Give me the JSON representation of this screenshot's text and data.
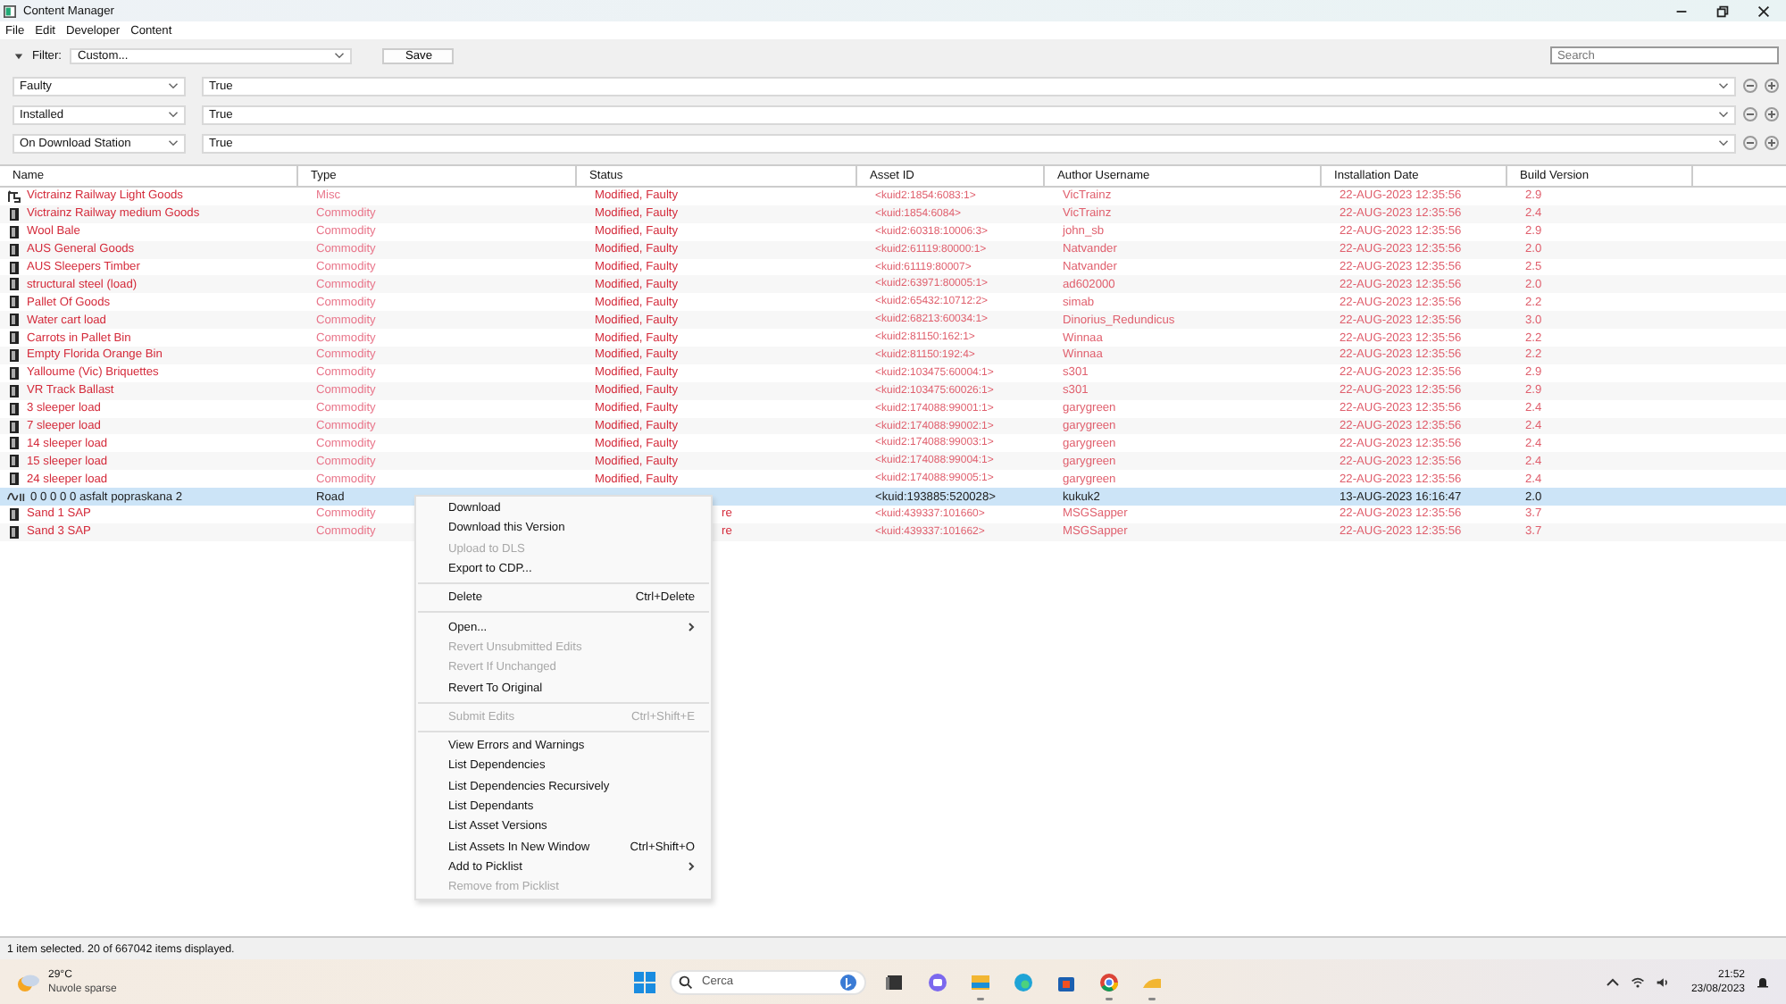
{
  "window": {
    "title": "Content Manager"
  },
  "menu_bar": [
    "File",
    "Edit",
    "Developer",
    "Content"
  ],
  "filter": {
    "label": "Filter:",
    "preset": "Custom...",
    "save": "Save",
    "search_placeholder": "Search",
    "expanded": true
  },
  "filter_rows": [
    {
      "field": "Faulty",
      "value": "True"
    },
    {
      "field": "Installed",
      "value": "True"
    },
    {
      "field": "On Download Station",
      "value": "True"
    }
  ],
  "table": {
    "columns": [
      "Name",
      "Type",
      "Status",
      "Asset ID",
      "Author Username",
      "Installation Date",
      "Build Version"
    ],
    "rows": [
      {
        "kind": "misc",
        "faulty": true,
        "selected": false,
        "cells": [
          "Victrainz Railway Light Goods",
          "Misc",
          "Modified, Faulty",
          "<kuid2:1854:6083:1>",
          "VicTrainz",
          "22-AUG-2023 12:35:56",
          "2.9"
        ]
      },
      {
        "kind": "commodity",
        "faulty": true,
        "selected": false,
        "cells": [
          "Victrainz Railway medium Goods",
          "Commodity",
          "Modified, Faulty",
          "<kuid:1854:6084>",
          "VicTrainz",
          "22-AUG-2023 12:35:56",
          "2.4"
        ]
      },
      {
        "kind": "commodity",
        "faulty": true,
        "selected": false,
        "cells": [
          "Wool Bale",
          "Commodity",
          "Modified, Faulty",
          "<kuid2:60318:10006:3>",
          "john_sb",
          "22-AUG-2023 12:35:56",
          "2.9"
        ]
      },
      {
        "kind": "commodity",
        "faulty": true,
        "selected": false,
        "cells": [
          "AUS General Goods",
          "Commodity",
          "Modified, Faulty",
          "<kuid2:61119:80000:1>",
          "Natvander",
          "22-AUG-2023 12:35:56",
          "2.0"
        ]
      },
      {
        "kind": "commodity",
        "faulty": true,
        "selected": false,
        "cells": [
          "AUS Sleepers Timber",
          "Commodity",
          "Modified, Faulty",
          "<kuid:61119:80007>",
          "Natvander",
          "22-AUG-2023 12:35:56",
          "2.5"
        ]
      },
      {
        "kind": "commodity",
        "faulty": true,
        "selected": false,
        "cells": [
          "structural steel (load)",
          "Commodity",
          "Modified, Faulty",
          "<kuid2:63971:80005:1>",
          "ad602000",
          "22-AUG-2023 12:35:56",
          "2.0"
        ]
      },
      {
        "kind": "commodity",
        "faulty": true,
        "selected": false,
        "cells": [
          "Pallet Of Goods",
          "Commodity",
          "Modified, Faulty",
          "<kuid2:65432:10712:2>",
          "simab",
          "22-AUG-2023 12:35:56",
          "2.2"
        ]
      },
      {
        "kind": "commodity",
        "faulty": true,
        "selected": false,
        "cells": [
          "Water cart load",
          "Commodity",
          "Modified, Faulty",
          "<kuid2:68213:60034:1>",
          "Dinorius_Redundicus",
          "22-AUG-2023 12:35:56",
          "3.0"
        ]
      },
      {
        "kind": "commodity",
        "faulty": true,
        "selected": false,
        "cells": [
          "Carrots in Pallet Bin",
          "Commodity",
          "Modified, Faulty",
          "<kuid2:81150:162:1>",
          "Winnaa",
          "22-AUG-2023 12:35:56",
          "2.2"
        ]
      },
      {
        "kind": "commodity",
        "faulty": true,
        "selected": false,
        "cells": [
          "Empty Florida Orange Bin",
          "Commodity",
          "Modified, Faulty",
          "<kuid2:81150:192:4>",
          "Winnaa",
          "22-AUG-2023 12:35:56",
          "2.2"
        ]
      },
      {
        "kind": "commodity",
        "faulty": true,
        "selected": false,
        "cells": [
          "Yalloume (Vic) Briquettes",
          "Commodity",
          "Modified, Faulty",
          "<kuid2:103475:60004:1>",
          "s301",
          "22-AUG-2023 12:35:56",
          "2.9"
        ]
      },
      {
        "kind": "commodity",
        "faulty": true,
        "selected": false,
        "cells": [
          "VR Track Ballast",
          "Commodity",
          "Modified, Faulty",
          "<kuid2:103475:60026:1>",
          "s301",
          "22-AUG-2023 12:35:56",
          "2.9"
        ]
      },
      {
        "kind": "commodity",
        "faulty": true,
        "selected": false,
        "cells": [
          "3 sleeper load",
          "Commodity",
          "Modified, Faulty",
          "<kuid2:174088:99001:1>",
          "garygreen",
          "22-AUG-2023 12:35:56",
          "2.4"
        ]
      },
      {
        "kind": "commodity",
        "faulty": true,
        "selected": false,
        "cells": [
          "7 sleeper load",
          "Commodity",
          "Modified, Faulty",
          "<kuid2:174088:99002:1>",
          "garygreen",
          "22-AUG-2023 12:35:56",
          "2.4"
        ]
      },
      {
        "kind": "commodity",
        "faulty": true,
        "selected": false,
        "cells": [
          "14 sleeper load",
          "Commodity",
          "Modified, Faulty",
          "<kuid2:174088:99003:1>",
          "garygreen",
          "22-AUG-2023 12:35:56",
          "2.4"
        ]
      },
      {
        "kind": "commodity",
        "faulty": true,
        "selected": false,
        "cells": [
          "15 sleeper load",
          "Commodity",
          "Modified, Faulty",
          "<kuid2:174088:99004:1>",
          "garygreen",
          "22-AUG-2023 12:35:56",
          "2.4"
        ]
      },
      {
        "kind": "commodity",
        "faulty": true,
        "selected": false,
        "cells": [
          "24 sleeper load",
          "Commodity",
          "Modified, Faulty",
          "<kuid2:174088:99005:1>",
          "garygreen",
          "22-AUG-2023 12:35:56",
          "2.4"
        ]
      },
      {
        "kind": "road",
        "faulty": false,
        "selected": true,
        "cells": [
          "0 0 0 0 0 asfalt popraskana 2",
          "Road",
          "",
          "<kuid:193885:520028>",
          "kukuk2",
          "13-AUG-2023 16:16:47",
          "2.0"
        ]
      },
      {
        "kind": "commodity",
        "faulty": true,
        "selected": false,
        "cells": [
          "Sand 1 SAP",
          "Commodity",
          "re",
          "<kuid:439337:101660>",
          "MSGSapper",
          "22-AUG-2023 12:35:56",
          "3.7"
        ],
        "status_covered": true
      },
      {
        "kind": "commodity",
        "faulty": true,
        "selected": false,
        "cells": [
          "Sand 3 SAP",
          "Commodity",
          "re",
          "<kuid:439337:101662>",
          "MSGSapper",
          "22-AUG-2023 12:35:56",
          "3.7"
        ],
        "status_covered": true
      }
    ]
  },
  "context_menu": [
    {
      "kind": "item",
      "label": "Download",
      "disabled": false
    },
    {
      "kind": "item",
      "label": "Download this Version",
      "disabled": false
    },
    {
      "kind": "item",
      "label": "Upload to DLS",
      "disabled": true
    },
    {
      "kind": "item",
      "label": "Export to CDP...",
      "disabled": false
    },
    {
      "kind": "separator"
    },
    {
      "kind": "item",
      "label": "Delete",
      "shortcut": "Ctrl+Delete",
      "disabled": false
    },
    {
      "kind": "separator"
    },
    {
      "kind": "item",
      "label": "Open...",
      "submenu": true,
      "disabled": false
    },
    {
      "kind": "item",
      "label": "Revert Unsubmitted Edits",
      "disabled": true
    },
    {
      "kind": "item",
      "label": "Revert If Unchanged",
      "disabled": true
    },
    {
      "kind": "item",
      "label": "Revert To Original",
      "disabled": false
    },
    {
      "kind": "separator"
    },
    {
      "kind": "item",
      "label": "Submit Edits",
      "shortcut": "Ctrl+Shift+E",
      "disabled": true
    },
    {
      "kind": "separator"
    },
    {
      "kind": "item",
      "label": "View Errors and Warnings",
      "disabled": false
    },
    {
      "kind": "item",
      "label": "List Dependencies",
      "disabled": false
    },
    {
      "kind": "item",
      "label": "List Dependencies Recursively",
      "disabled": false
    },
    {
      "kind": "item",
      "label": "List Dependants",
      "disabled": false
    },
    {
      "kind": "item",
      "label": "List Asset Versions",
      "disabled": false
    },
    {
      "kind": "item",
      "label": "List Assets In New Window",
      "shortcut": "Ctrl+Shift+O",
      "disabled": false
    },
    {
      "kind": "item",
      "label": "Add to Picklist",
      "submenu": true,
      "disabled": false
    },
    {
      "kind": "item",
      "label": "Remove from Picklist",
      "disabled": true
    }
  ],
  "status_bar": "1 item selected. 20 of 667042 items displayed.",
  "taskbar": {
    "temperature": "29°C",
    "weather": "Nuvole sparse",
    "search_placeholder": "Cerca",
    "time": "21:52",
    "date": "23/08/2023",
    "apps": [
      {
        "kind": "files",
        "active": false
      },
      {
        "kind": "chat",
        "active": false
      },
      {
        "kind": "folder",
        "active": true
      },
      {
        "kind": "edge",
        "active": false
      },
      {
        "kind": "store",
        "active": false
      },
      {
        "kind": "chrome",
        "active": true
      },
      {
        "kind": "trainz",
        "active": true
      }
    ]
  }
}
